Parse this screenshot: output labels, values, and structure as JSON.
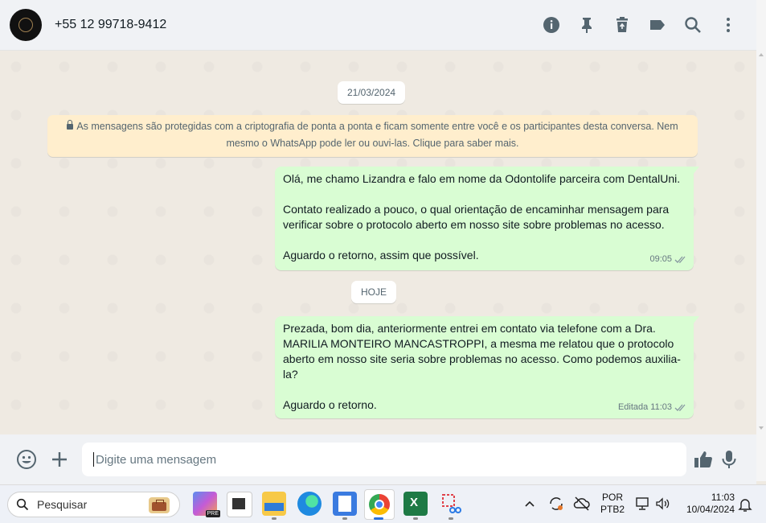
{
  "header": {
    "contact_name": "+55 12 99718-9412",
    "icons": [
      "info-icon",
      "pin-icon",
      "trash-icon",
      "label-icon",
      "search-icon",
      "menu-dots-icon"
    ]
  },
  "chat": {
    "date_first": "21/03/2024",
    "encryption_notice_line1": "As mensagens são protegidas com a criptografia de ponta a ponta e ficam somente entre você e os participantes desta conversa. Nem",
    "encryption_notice_line2": "mesmo o WhatsApp pode ler ou ouvi-las. Clique para saber mais.",
    "date_second": "HOJE",
    "messages": [
      {
        "paragraphs": [
          "Olá, me chamo Lizandra e falo em nome da Odontolife parceira com DentalUni.",
          "Contato realizado a pouco, o qual orientação de encaminhar mensagem para verificar sobre o protocolo aberto em nosso site sobre problemas no acesso.",
          "Aguardo o retorno, assim que possível."
        ],
        "edited": "",
        "time": "09:05"
      },
      {
        "paragraphs": [
          "Prezada, bom dia, anteriormente entrei em contato via telefone com a Dra. MARILIA MONTEIRO MANCASTROPPI, a mesma me relatou que o protocolo aberto em nosso site seria sobre problemas no acesso. Como podemos auxilia-la?",
          "Aguardo o retorno."
        ],
        "edited": "Editada",
        "time": "11:03"
      }
    ]
  },
  "composer": {
    "placeholder": "Digite uma mensagem"
  },
  "taskbar": {
    "search_label": "Pesquisar",
    "lang_line1": "POR",
    "lang_line2": "PTB2",
    "time": "11:03",
    "date": "10/04/2024",
    "pre_badge": "PRE"
  },
  "colors": {
    "outgoing_bubble": "#d9fdd3",
    "encryption_banner": "#ffeecd",
    "read_ticks": "#8696a0"
  }
}
